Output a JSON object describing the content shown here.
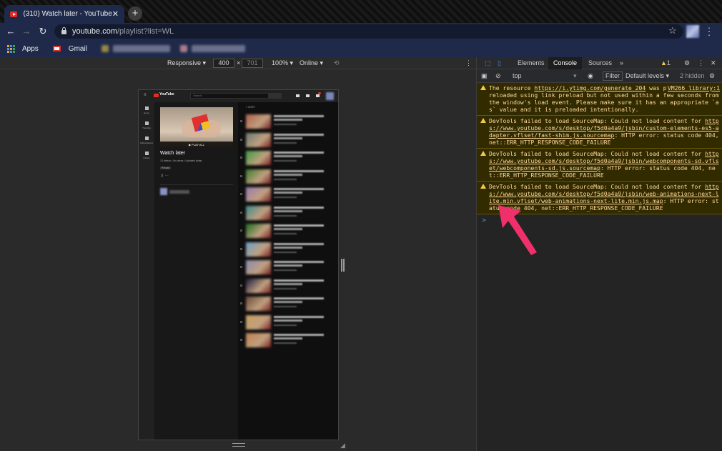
{
  "browser": {
    "tab_title": "(310) Watch later - YouTube",
    "url_host": "youtube.com",
    "url_path": "/playlist?list=WL",
    "bookmarks": [
      {
        "label": "Apps",
        "icon": "apps-grid-icon"
      },
      {
        "label": "Gmail",
        "icon": "gmail-icon"
      }
    ]
  },
  "device_toolbar": {
    "mode": "Responsive",
    "width": "400",
    "height": "701",
    "zoom": "100%",
    "network": "Online",
    "times": "×"
  },
  "youtube": {
    "logo": "YouTube",
    "search_placeholder": "Search",
    "sidebar": [
      "Home",
      "Trending",
      "Subscriptions",
      "Library"
    ],
    "playlist_title": "Watch later",
    "playlist_meta": "13 videos • No views • Updated today",
    "privacy": "Private",
    "play_all": "▶ PLAY ALL",
    "sort": "SORT",
    "video_thumbs": [
      "#b0604a",
      "#6a7a70",
      "#3c9a40",
      "#3f7a2e",
      "#9a7ab0",
      "#3a8a8a",
      "#1a6a20",
      "#6aa0c8",
      "#8a8ab0",
      "#1a1a3a",
      "#6a4a3a",
      "#c8a060",
      "#c08050"
    ]
  },
  "devtools": {
    "tabs": [
      "Elements",
      "Console",
      "Sources",
      "»"
    ],
    "warning_count": "1",
    "context": "top",
    "filter": "Filter",
    "levels": "Default levels ▾",
    "hidden": "2 hidden",
    "messages": [
      {
        "pre": "The resource ",
        "link": "https://i.ytimg.com/generate_204",
        "post": " was preloaded using link preload but not used within a few seconds from the window's load event. Please make sure it has an appropriate `as` value and it is preloaded intentionally.",
        "source": "VM266 library:1"
      },
      {
        "pre": "DevTools failed to load SourceMap: Could not load content for ",
        "link": "https://www.youtube.com/s/desktop/f5d0a4a9/jsbin/custom-elements-es5-adapter.vflset/fast-shim.js.sourcemap",
        "post": ": HTTP error: status code 404, net::ERR_HTTP_RESPONSE_CODE_FAILURE"
      },
      {
        "pre": "DevTools failed to load SourceMap: Could not load content for ",
        "link": "https://www.youtube.com/s/desktop/f5d0a4a9/jsbin/webcomponents-sd.vflset/webcomponents-sd.js.sourcemap",
        "post": ": HTTP error: status code 404, net::ERR_HTTP_RESPONSE_CODE_FAILURE"
      },
      {
        "pre": "DevTools failed to load SourceMap: Could not load content for ",
        "link": "https://www.youtube.com/s/desktop/f5d0a4a9/jsbin/web-animations-next-lite.min.vflset/web-animations-next-lite.min.js.map",
        "post": ": HTTP error: status code 404, net::ERR_HTTP_RESPONSE_CODE_FAILURE"
      }
    ],
    "prompt": ">"
  },
  "annotation": {
    "color": "#f0306a"
  }
}
